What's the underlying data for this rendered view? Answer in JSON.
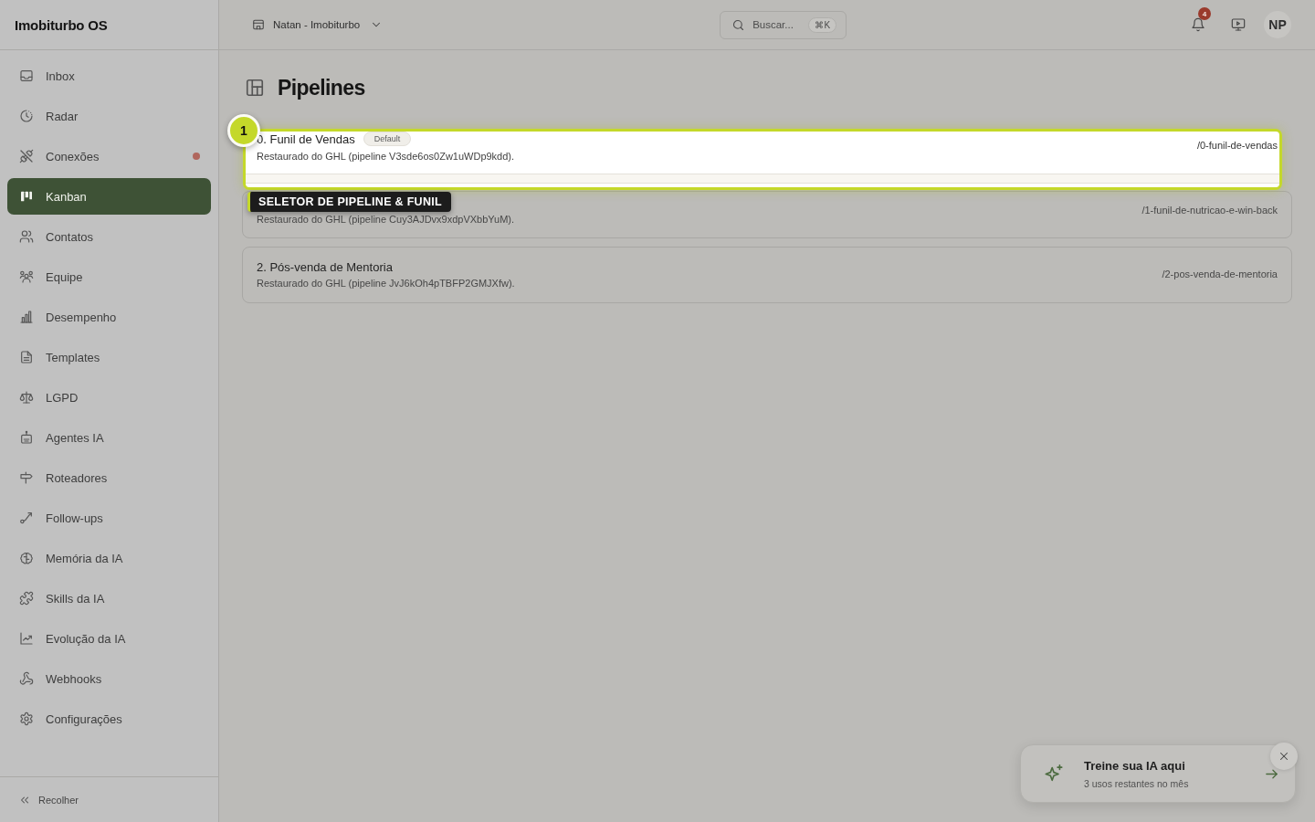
{
  "app": {
    "name": "Imobiturbo OS"
  },
  "nav": [
    {
      "label": "Inbox",
      "selected": false,
      "alert": false
    },
    {
      "label": "Radar",
      "selected": false,
      "alert": false
    },
    {
      "label": "Conexões",
      "selected": false,
      "alert": true
    },
    {
      "label": "Kanban",
      "selected": true,
      "alert": false
    },
    {
      "label": "Contatos",
      "selected": false,
      "alert": false
    },
    {
      "label": "Equipe",
      "selected": false,
      "alert": false
    },
    {
      "label": "Desempenho",
      "selected": false,
      "alert": false
    },
    {
      "label": "Templates",
      "selected": false,
      "alert": false
    },
    {
      "label": "LGPD",
      "selected": false,
      "alert": false
    },
    {
      "label": "Agentes IA",
      "selected": false,
      "alert": false
    },
    {
      "label": "Roteadores",
      "selected": false,
      "alert": false
    },
    {
      "label": "Follow-ups",
      "selected": false,
      "alert": false
    },
    {
      "label": "Memória da IA",
      "selected": false,
      "alert": false
    },
    {
      "label": "Skills da IA",
      "selected": false,
      "alert": false
    },
    {
      "label": "Evolução da IA",
      "selected": false,
      "alert": false
    },
    {
      "label": "Webhooks",
      "selected": false,
      "alert": false
    },
    {
      "label": "Configurações",
      "selected": false,
      "alert": false
    }
  ],
  "sidebar_footer": {
    "collapse_label": "Recolher"
  },
  "topbar": {
    "workspace": "Natan - Imobiturbo",
    "search": {
      "placeholder": "Buscar...",
      "shortcut": "⌘K"
    },
    "notifications": "4",
    "avatar": "NP"
  },
  "page": {
    "title": "Pipelines"
  },
  "pipelines": [
    {
      "title": "0. Funil de Vendas",
      "badge": "Default",
      "description": "Restaurado do GHL (pipeline V3sde6os0Zw1uWDp9kdd).",
      "slug": "/0-funil-de-vendas",
      "spotlight": true
    },
    {
      "description": "Restaurado do GHL (pipeline Cuy3AJDvx9xdpVXbbYuM).",
      "slug": "/1-funil-de-nutricao-e-win-back",
      "spotlight": false
    },
    {
      "title": "2. Pós-venda de Mentoria",
      "description": "Restaurado do GHL (pipeline JvJ6kOh4pTBFP2GMJXfw).",
      "slug": "/2-pos-venda-de-mentoria",
      "spotlight": false
    }
  ],
  "tour": {
    "step": "1",
    "tooltip": "SELETOR DE PIPELINE & FUNIL"
  },
  "promo": {
    "title": "Treine sua IA aqui",
    "subtitle": "3 usos restantes no mês"
  }
}
